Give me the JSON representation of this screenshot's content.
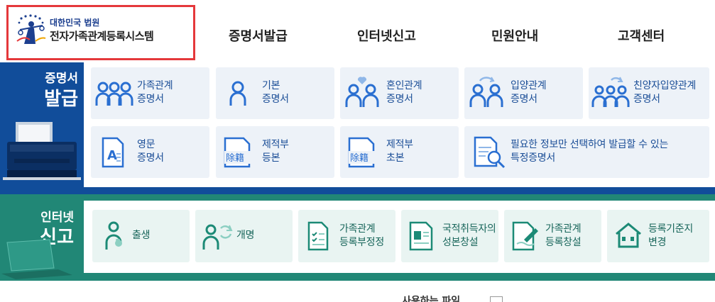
{
  "header": {
    "logo_sub": "대한민국 법원",
    "logo_title": "전자가족관계등록시스템",
    "nav": [
      {
        "label": "증명서발급"
      },
      {
        "label": "인터넷신고"
      },
      {
        "label": "민원안내"
      },
      {
        "label": "고객센터"
      }
    ]
  },
  "certificates": {
    "side_small": "증명서",
    "side_big": "발급",
    "tiles": [
      {
        "line1": "가족관계",
        "line2": "증명서",
        "icon": "family-icon"
      },
      {
        "line1": "기본",
        "line2": "증명서",
        "icon": "person-icon"
      },
      {
        "line1": "혼인관계",
        "line2": "증명서",
        "icon": "couple-heart-icon"
      },
      {
        "line1": "입양관계",
        "line2": "증명서",
        "icon": "adoption-icon"
      },
      {
        "line1": "친양자입양관계",
        "line2": "증명서",
        "icon": "family-adoption-icon"
      },
      {
        "line1": "영문",
        "line2": "증명서",
        "icon": "english-document-icon"
      },
      {
        "line1": "제적부",
        "line2": "등본",
        "icon": "register-document-icon"
      },
      {
        "line1": "제적부",
        "line2": "초본",
        "icon": "register-document-icon"
      },
      {
        "line1": "필요한 정보만 선택하여 발급할 수 있는",
        "line2": "특정증명서",
        "icon": "document-search-icon"
      }
    ],
    "doc_glyph": "除籍",
    "doc_glyph_en": "A"
  },
  "internet": {
    "side_small": "인터넷",
    "side_big": "신고",
    "tiles": [
      {
        "line1": "출생",
        "line2": "",
        "icon": "birth-icon"
      },
      {
        "line1": "개명",
        "line2": "",
        "icon": "rename-icon"
      },
      {
        "line1": "가족관계",
        "line2": "등록부정정",
        "icon": "checklist-document-icon"
      },
      {
        "line1": "국적취득자의",
        "line2": "성본창설",
        "icon": "id-card-icon"
      },
      {
        "line1": "가족관계",
        "line2": "등록창설",
        "icon": "document-pen-icon"
      },
      {
        "line1": "등록기준지",
        "line2": "변경",
        "icon": "house-icon"
      }
    ]
  },
  "footer": {
    "partial_text": "사용하는 파일"
  },
  "colors": {
    "blue": "#114d9a",
    "green": "#218776",
    "highlight": "#e5383b"
  }
}
